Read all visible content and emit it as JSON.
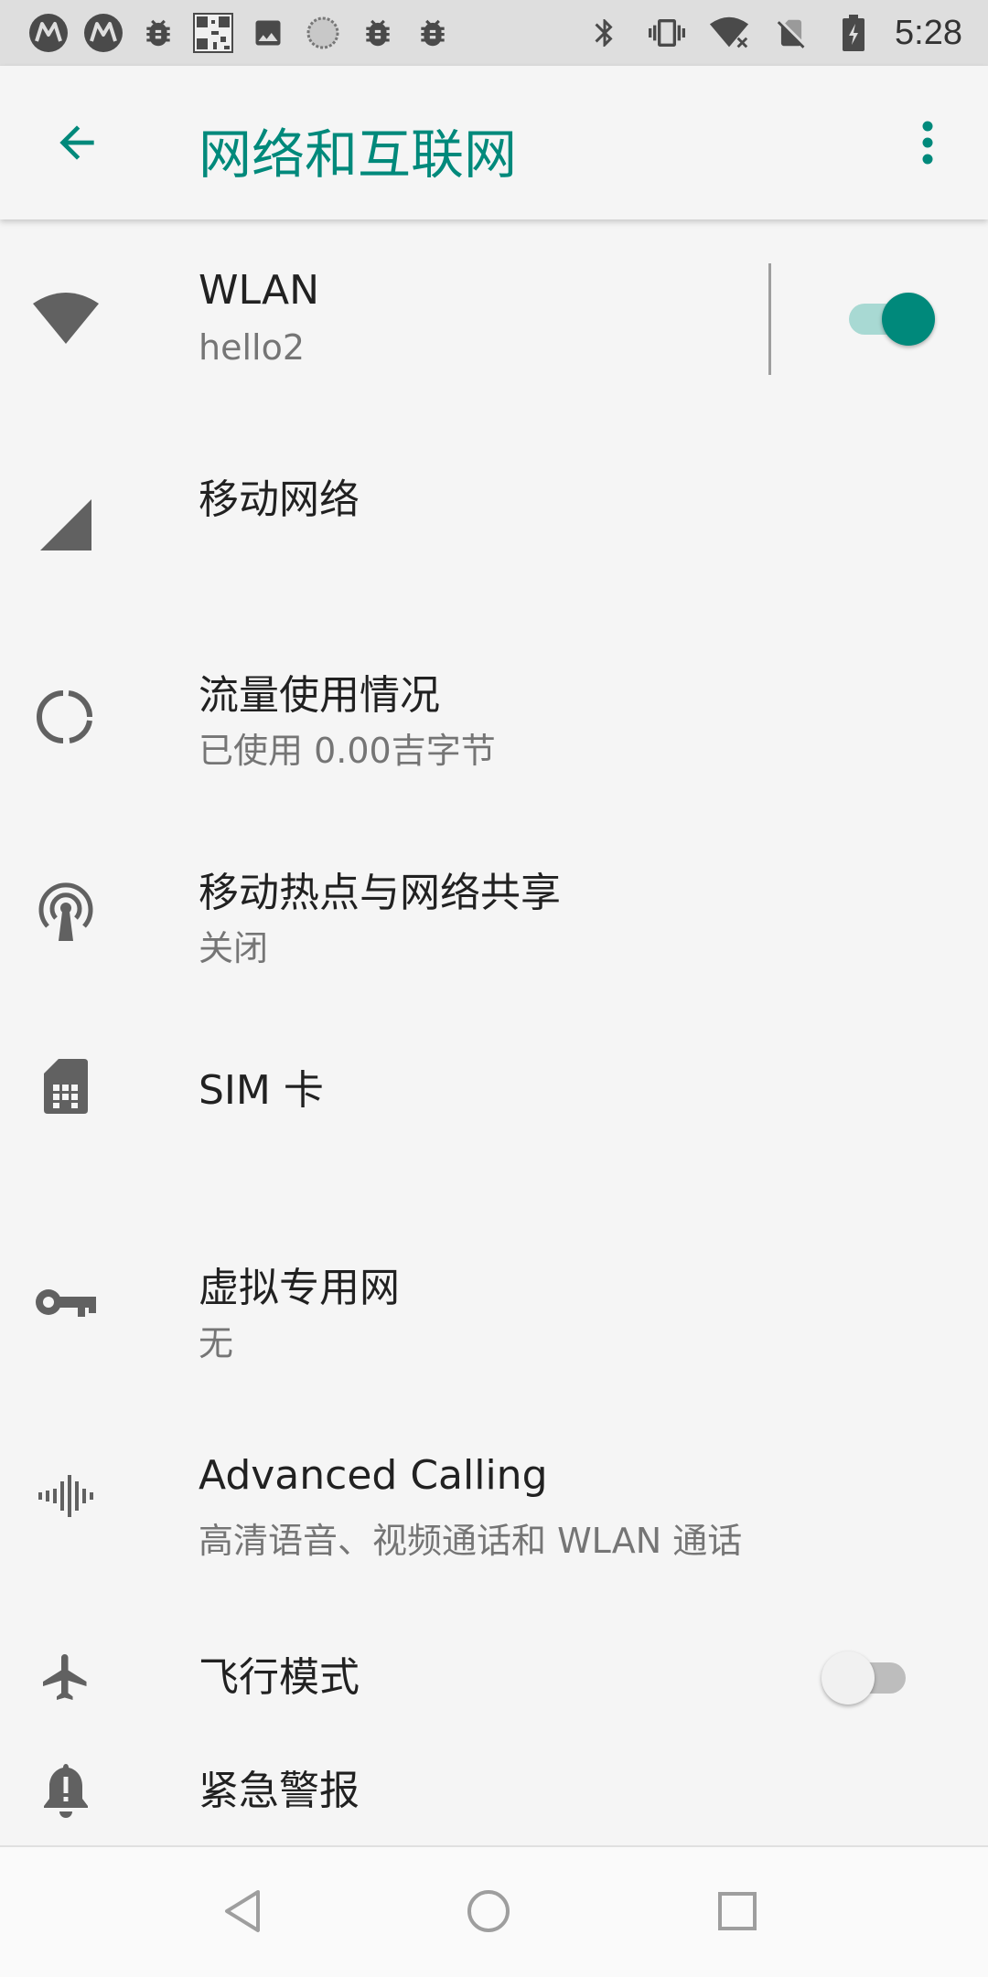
{
  "status_bar": {
    "time": "5:28",
    "left_icons": [
      "motorola-icon",
      "motorola-icon",
      "bug-icon",
      "qr-icon",
      "image-icon",
      "sync-icon",
      "bug-icon",
      "bug-icon"
    ],
    "right_icons": [
      "bluetooth-icon",
      "vibrate-icon",
      "wifi-icon",
      "no-sim-icon",
      "battery-icon"
    ]
  },
  "app_bar": {
    "title": "网络和互联网"
  },
  "settings": [
    {
      "id": "wlan",
      "icon": "wifi-icon",
      "label": "WLAN",
      "summary": "hello2",
      "toggle": true
    },
    {
      "id": "mobile-network",
      "icon": "signal-icon",
      "label": "移动网络",
      "summary": ""
    },
    {
      "id": "data-usage",
      "icon": "data-usage-icon",
      "label": "流量使用情况",
      "summary": "已使用 0.00吉字节"
    },
    {
      "id": "hotspot",
      "icon": "hotspot-icon",
      "label": "移动热点与网络共享",
      "summary": "关闭"
    },
    {
      "id": "sim",
      "icon": "sim-card-icon",
      "label": "SIM 卡",
      "summary": ""
    },
    {
      "id": "vpn",
      "icon": "key-icon",
      "label": "虚拟专用网",
      "summary": "无"
    },
    {
      "id": "advanced-calling",
      "icon": "voice-wave-icon",
      "label": "Advanced Calling",
      "summary": "高清语音、视频通话和 WLAN 通话"
    },
    {
      "id": "airplane",
      "icon": "airplane-icon",
      "label": "飞行模式",
      "summary": "",
      "toggle": false
    },
    {
      "id": "emergency",
      "icon": "alert-bell-icon",
      "label": "紧急警报",
      "summary": ""
    }
  ],
  "colors": {
    "accent": "#00897b",
    "accent_track": "#a8d9d3",
    "icon_gray": "#616161",
    "background": "#f5f5f5"
  }
}
